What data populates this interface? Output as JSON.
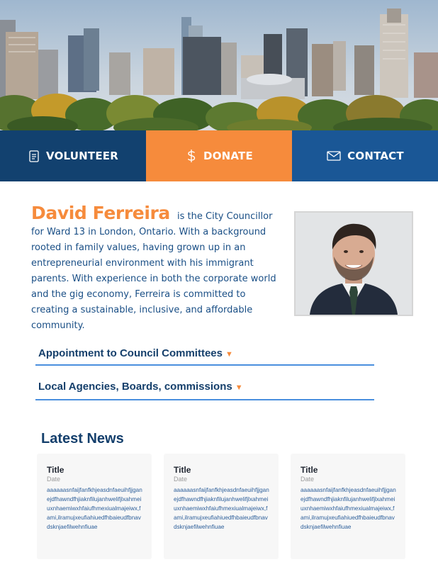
{
  "actions": {
    "volunteer": "VOLUNTEER",
    "donate": "DONATE",
    "contact": "CONTACT",
    "icons": [
      "document-icon",
      "dollar-icon",
      "envelope-icon"
    ]
  },
  "bio": {
    "name": "David Ferreira",
    "text": "is the City Councillor for Ward 13 in London, Ontario. With a background rooted in family values, having grown up in an entrepreneurial environment with his immigrant parents. With experience in both the corporate world and the gig economy, Ferreira is committed to creating a sustainable, inclusive, and affordable community."
  },
  "accordions": [
    {
      "label": "Appointment to Council Committees"
    },
    {
      "label": "Local Agencies, Boards, commissions"
    }
  ],
  "news": {
    "heading": "Latest News",
    "cards": [
      {
        "title": "Title",
        "date": "Date",
        "body": "aaaaaasnfaijfanfkhjeasdnfaeuihfjjganejdfhawndfhjiaknfilujanhwelifjlxahmeiuxnhaemiwxhfaiufhmexiualmajeiwx,fami,ilramujxeufiahiuedfhbaieudfbnavdsknjaefilwehnfiuae"
      },
      {
        "title": "Title",
        "date": "Date",
        "body": "aaaaaasnfaijfanfkhjeasdnfaeuihfjjganejdfhawndfhjiaknfilujanhwelifjlxahmeiuxnhaemiwxhfaiufhmexiualmajeiwx,fami,ilramujxeufiahiuedfhbaieudfbnavdsknjaefilwehnfiuae"
      },
      {
        "title": "Title",
        "date": "Date",
        "body": "aaaaaasnfaijfanfkhjeasdnfaeuihfjjganejdfhawndfhjiaknfilujanhwelifjlxahmeiuxnhaemiwxhfaiufhmexiualmajeiwx,fami,ilramujxeufiahiuedfhbaieudfbnavdsknjaefilwehnfiuae"
      }
    ]
  },
  "colors": {
    "navy": "#12416f",
    "orange": "#f68b3c",
    "blue": "#1a5796",
    "text_blue": "#1a4f86"
  }
}
